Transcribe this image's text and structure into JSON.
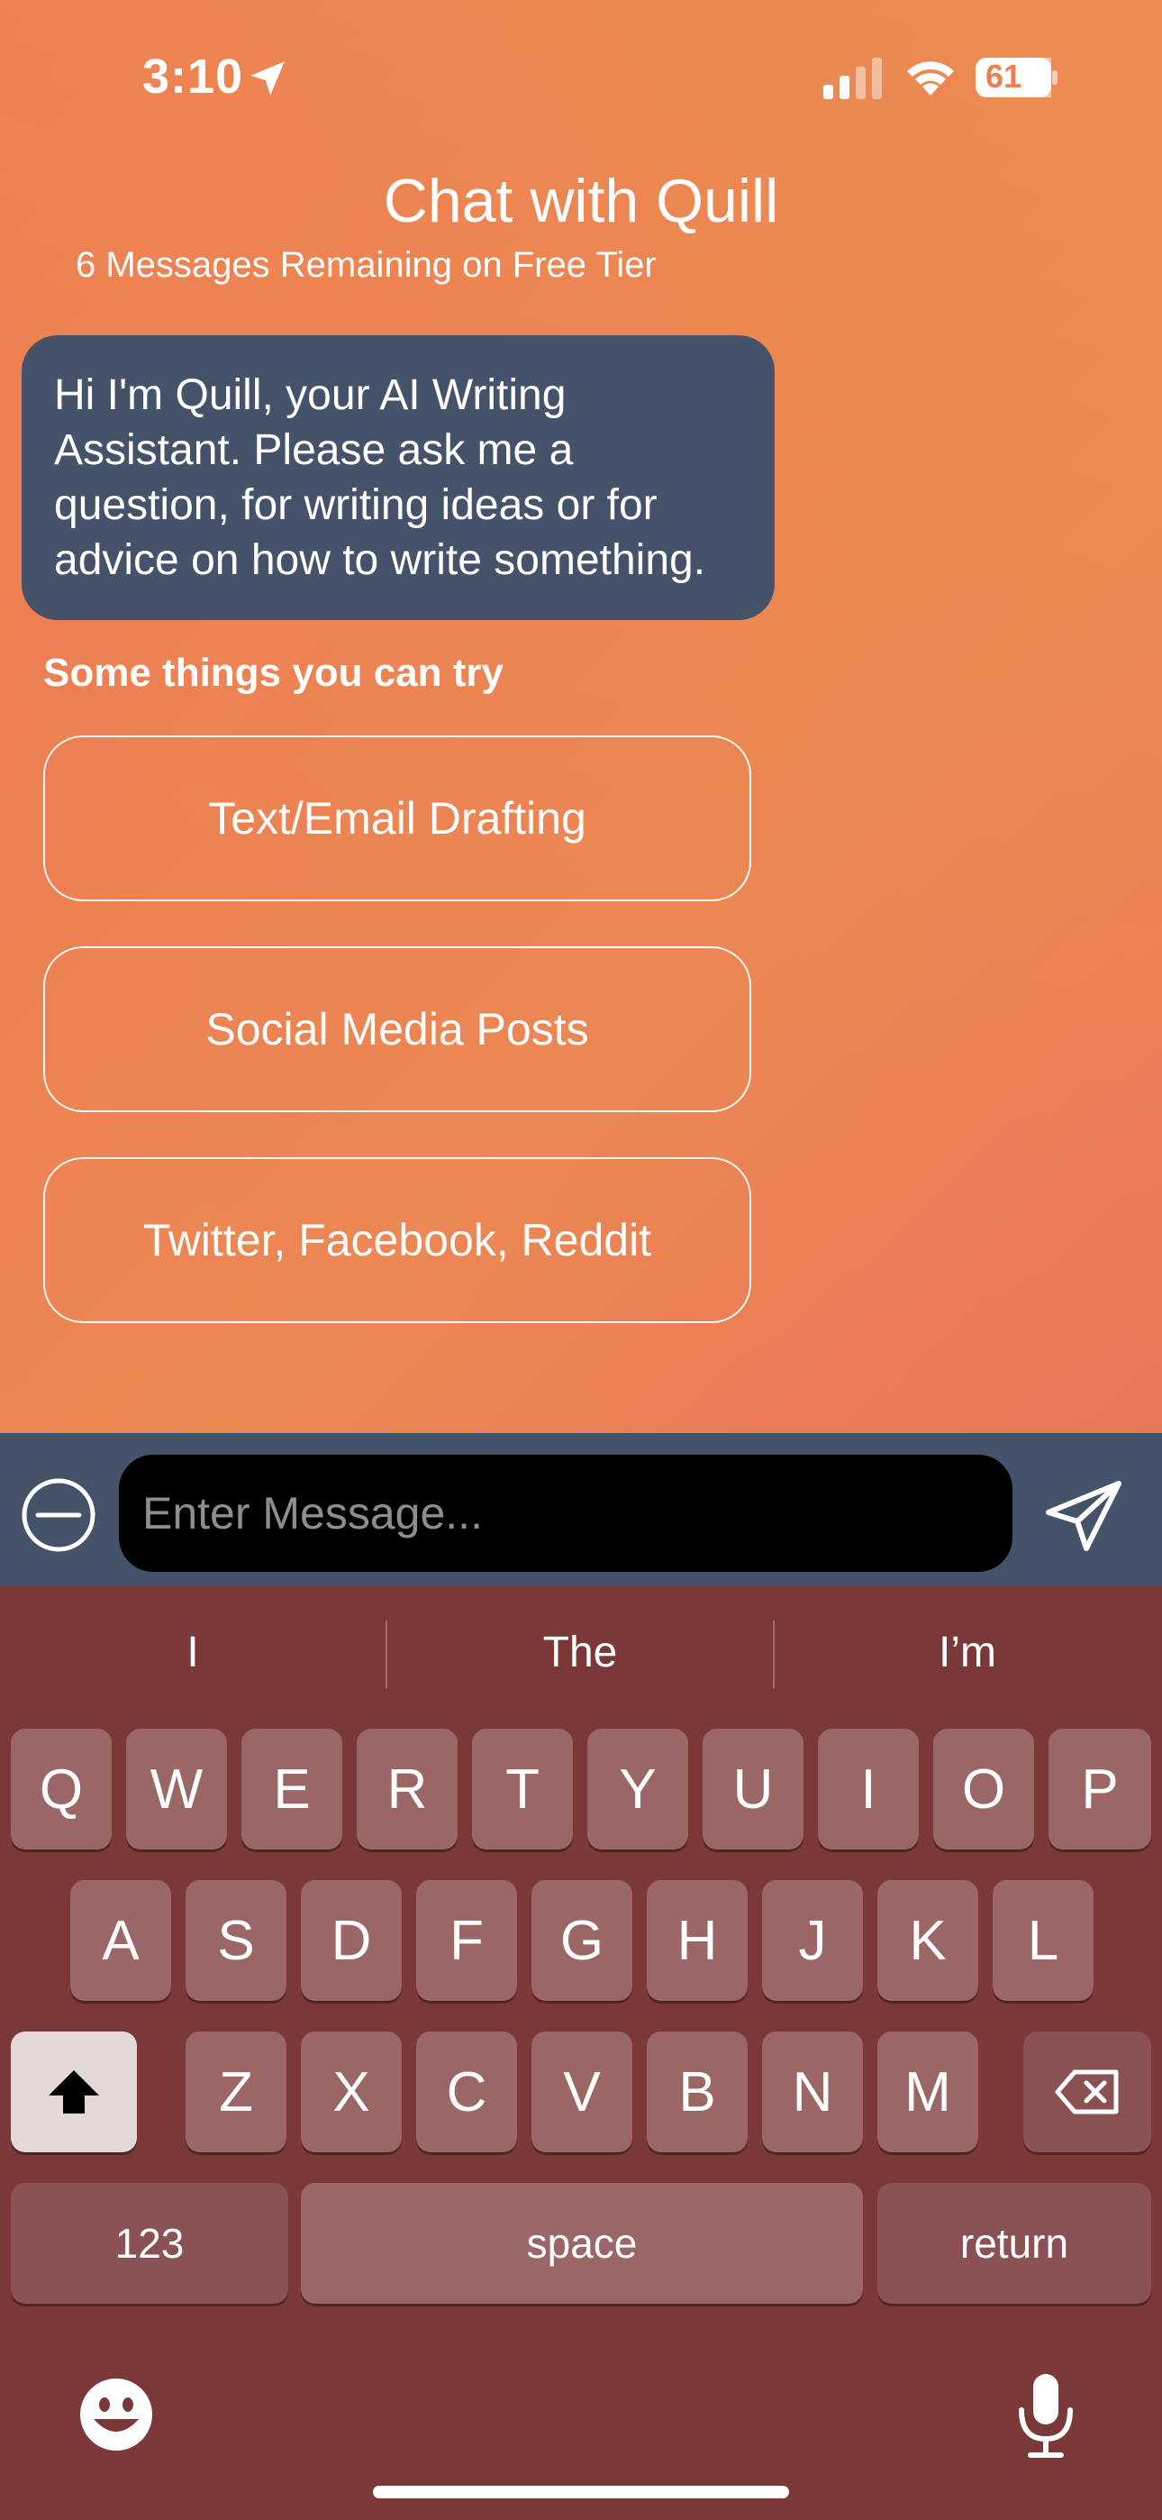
{
  "status_bar": {
    "time": "3:10",
    "battery": "61"
  },
  "header": {
    "title": "Chat with Quill",
    "subtitle": "6 Messages Remaining on Free Tier"
  },
  "assistant_message": "Hi I'm Quill, your AI Writing Assistant. Please ask me a question, for writing ideas or for advice on how to write something.",
  "suggestions_label": "Some things you can try",
  "suggestions": [
    "Text/Email Drafting",
    "Social Media Posts",
    "Twitter, Facebook, Reddit"
  ],
  "composer": {
    "placeholder": "Enter Message..."
  },
  "keyboard": {
    "predictions": [
      "I",
      "The",
      "I’m"
    ],
    "row1": [
      "Q",
      "W",
      "E",
      "R",
      "T",
      "Y",
      "U",
      "I",
      "O",
      "P"
    ],
    "row2": [
      "A",
      "S",
      "D",
      "F",
      "G",
      "H",
      "J",
      "K",
      "L"
    ],
    "row3": [
      "Z",
      "X",
      "C",
      "V",
      "B",
      "N",
      "M"
    ],
    "numbers_key": "123",
    "space_key": "space",
    "return_key": "return"
  },
  "colors": {
    "bubble": "#44536a",
    "keyboard": "#7b3838",
    "gradient_top": "#ec8a53",
    "gradient_bottom": "#e6525a"
  }
}
